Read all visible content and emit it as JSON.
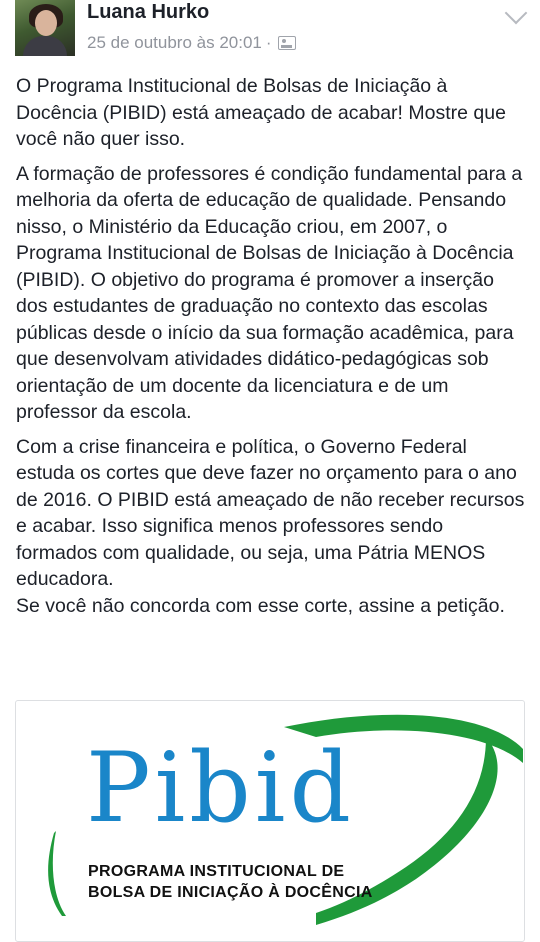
{
  "post": {
    "author": "Luana Hurko",
    "timestamp": "25 de outubro às 20:01",
    "separator": "·",
    "privacy_icon": "group-privacy-icon",
    "menu_icon": "chevron-down-icon",
    "paragraphs": [
      "O Programa Institucional de Bolsas de Iniciação à Docência (PIBID) está ameaçado de acabar! Mostre que você não quer isso.",
      "A formação de professores é condição fundamental para a melhoria da oferta de educação de qualidade. Pensando nisso, o Ministério da Educação criou, em 2007, o Programa Institucional de Bolsas de Iniciação à Docência (PIBID). O objetivo do programa é promover a inserção dos estudantes de graduação no contexto das escolas públicas desde o início da sua formação acadêmica, para que desenvolvam atividades didático-pedagógicas sob orientação de um docente da licenciatura e de um professor da escola.",
      "Com a crise financeira e política, o Governo Federal estuda os cortes que deve fazer no orçamento para o ano de 2016. O PIBID está ameaçado de não receber recursos e acabar. Isso significa menos professores sendo formados com qualidade, ou seja, uma Pátria MENOS educadora.",
      "Se você não concorda com esse corte, assine a petição."
    ]
  },
  "link_preview": {
    "logo_word": "Pibid",
    "logo_line1": "PROGRAMA INSTITUCIONAL DE",
    "logo_line2": "BOLSA DE INICIAÇÃO À DOCÊNCIA",
    "colors": {
      "blue": "#1a86c9",
      "green": "#1f9a3a",
      "text": "#111111"
    }
  }
}
